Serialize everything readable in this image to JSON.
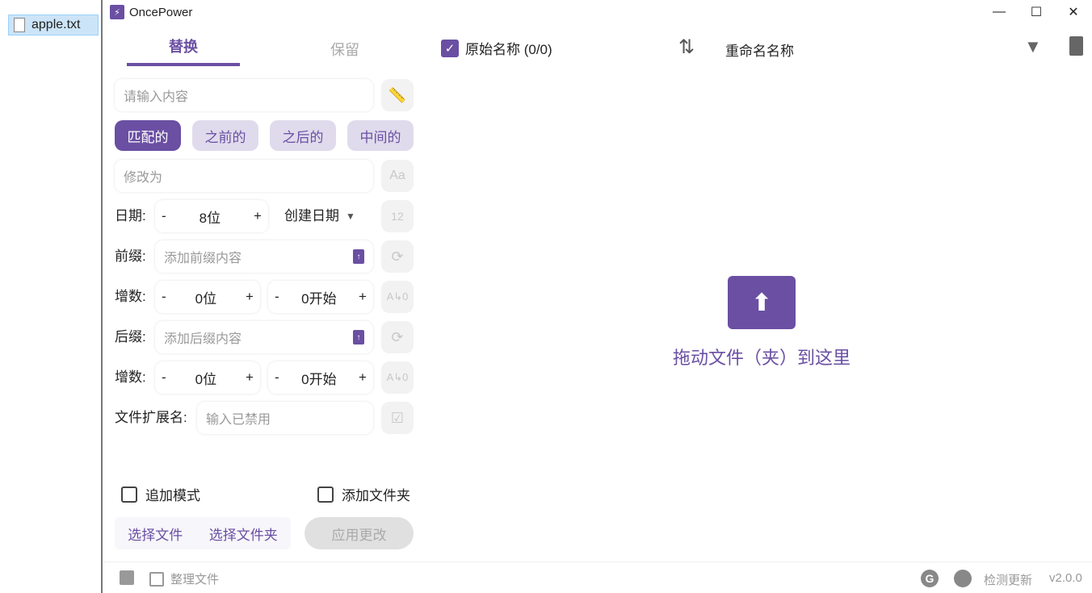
{
  "desktop": {
    "file_name": "apple.txt"
  },
  "app": {
    "title": "OncePower",
    "version": "v2.0.0"
  },
  "tabs": [
    {
      "label": "替换",
      "active": true
    },
    {
      "label": "保留",
      "active": false
    }
  ],
  "replace": {
    "search_placeholder": "请输入内容",
    "modes": [
      "匹配的",
      "之前的",
      "之后的",
      "中间的"
    ],
    "active_mode": "匹配的",
    "modify_placeholder": "修改为"
  },
  "date": {
    "label": "日期:",
    "minus": "-",
    "value": "8位",
    "plus": "+",
    "type": "创建日期"
  },
  "prefix": {
    "label": "前缀:",
    "placeholder": "添加前缀内容"
  },
  "prefix_incr": {
    "label": "增数:",
    "digits": "0位",
    "start": "0开始",
    "minus": "-",
    "plus": "+"
  },
  "suffix": {
    "label": "后缀:",
    "placeholder": "添加后缀内容"
  },
  "suffix_incr": {
    "label": "增数:",
    "digits": "0位",
    "start": "0开始",
    "minus": "-",
    "plus": "+"
  },
  "extension": {
    "label": "文件扩展名:",
    "placeholder": "输入已禁用"
  },
  "options": {
    "append_mode": "追加模式",
    "add_folder": "添加文件夹"
  },
  "actions": {
    "select_files": "选择文件",
    "select_folder": "选择文件夹",
    "apply": "应用更改"
  },
  "list_header": {
    "original_name": "原始名称 (0/0)",
    "original_checked": true,
    "rename_name": "重命名名称"
  },
  "dropzone": {
    "text": "拖动文件（夹）到这里"
  },
  "footer": {
    "organize": "整理文件",
    "check_update": "检测更新"
  },
  "colors": {
    "accent": "#6a4fa3",
    "chip_bg": "#e0dbec"
  }
}
